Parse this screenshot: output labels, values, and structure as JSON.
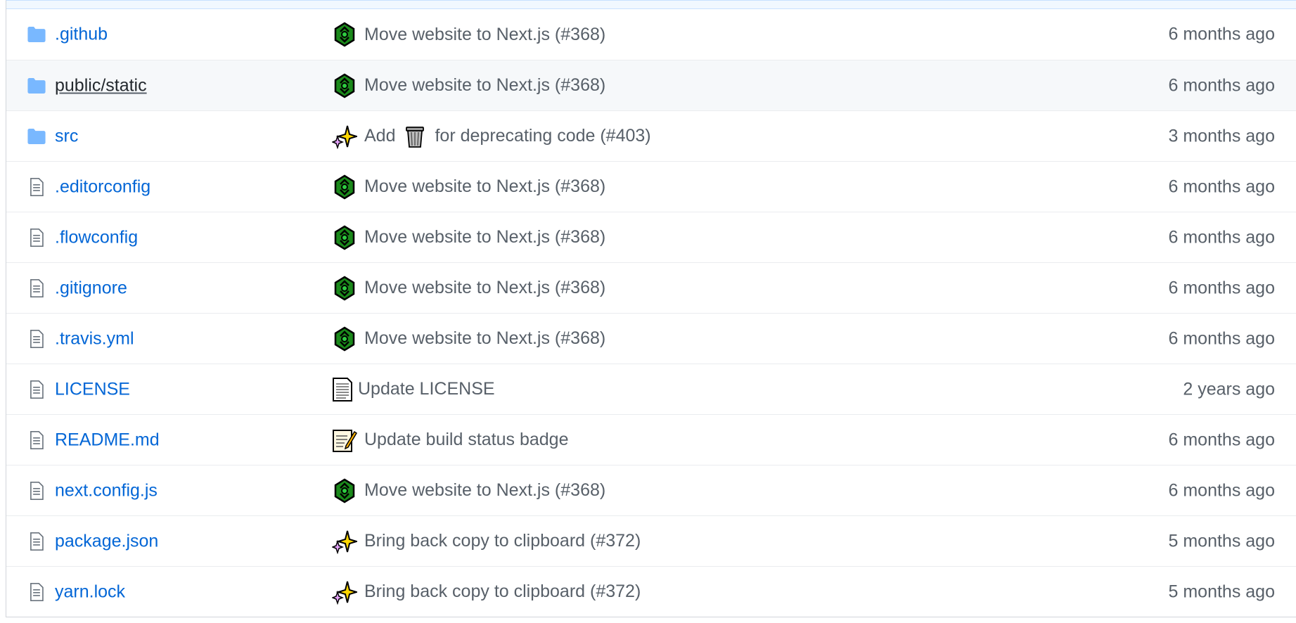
{
  "files": [
    {
      "type": "folder",
      "name": ".github",
      "emoji": "recycle-icon",
      "message": "Move website to Next.js (#368)",
      "age": "6 months ago"
    },
    {
      "type": "folder",
      "name": "public/static",
      "emoji": "recycle-icon",
      "message": "Move website to Next.js (#368)",
      "age": "6 months ago"
    },
    {
      "type": "folder",
      "name": "src",
      "emoji": "sparkles-icon",
      "message_before": "Add",
      "inline_emoji": "wastebasket-icon",
      "message_after": "for deprecating code (#403)",
      "age": "3 months ago"
    },
    {
      "type": "file",
      "name": ".editorconfig",
      "emoji": "recycle-icon",
      "message": "Move website to Next.js (#368)",
      "age": "6 months ago"
    },
    {
      "type": "file",
      "name": ".flowconfig",
      "emoji": "recycle-icon",
      "message": "Move website to Next.js (#368)",
      "age": "6 months ago"
    },
    {
      "type": "file",
      "name": ".gitignore",
      "emoji": "recycle-icon",
      "message": "Move website to Next.js (#368)",
      "age": "6 months ago"
    },
    {
      "type": "file",
      "name": ".travis.yml",
      "emoji": "recycle-icon",
      "message": "Move website to Next.js (#368)",
      "age": "6 months ago"
    },
    {
      "type": "file",
      "name": "LICENSE",
      "emoji": "page-icon",
      "message": "Update LICENSE",
      "age": "2 years ago"
    },
    {
      "type": "file",
      "name": "README.md",
      "emoji": "memo-icon",
      "message": "Update build status badge",
      "age": "6 months ago"
    },
    {
      "type": "file",
      "name": "next.config.js",
      "emoji": "recycle-icon",
      "message": "Move website to Next.js (#368)",
      "age": "6 months ago"
    },
    {
      "type": "file",
      "name": "package.json",
      "emoji": "sparkles-icon",
      "message": "Bring back copy to clipboard (#372)",
      "age": "5 months ago"
    },
    {
      "type": "file",
      "name": "yarn.lock",
      "emoji": "sparkles-icon",
      "message": "Bring back copy to clipboard (#372)",
      "age": "5 months ago"
    }
  ],
  "colors": {
    "link": "#0366d6",
    "muted": "#586069",
    "folder_icon": "#79b8ff",
    "hover_row": "#f6f8fa"
  }
}
